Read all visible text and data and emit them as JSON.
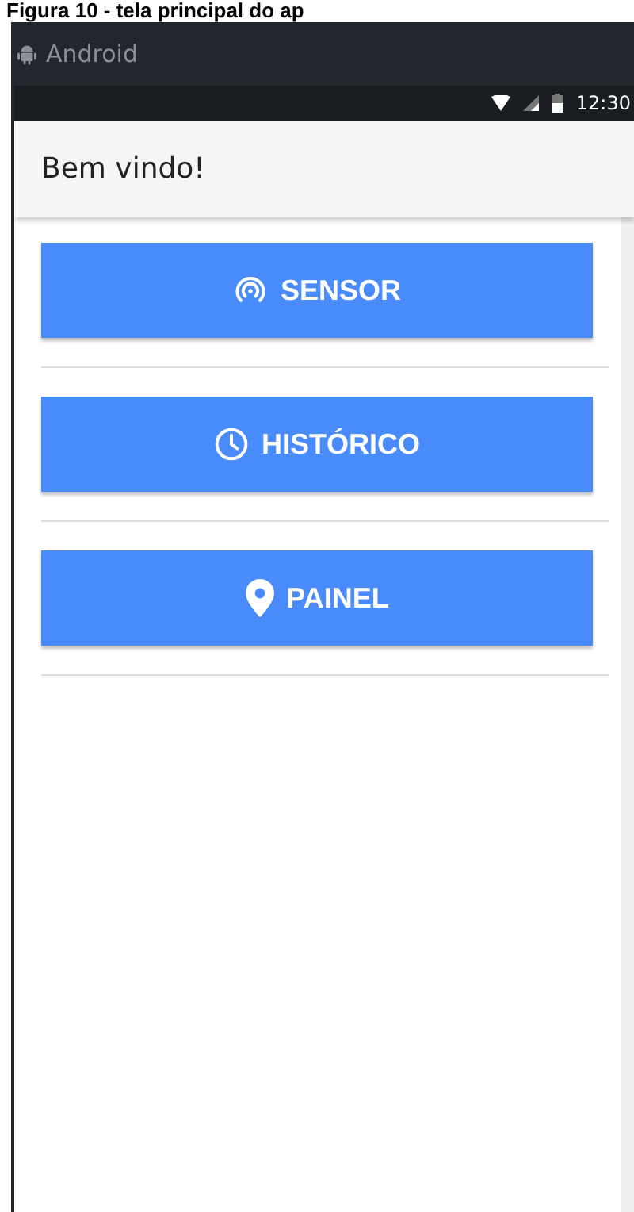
{
  "caption": "Figura 10 - tela principal do ap",
  "window": {
    "title": "Android"
  },
  "status_bar": {
    "time": "12:30"
  },
  "app_bar": {
    "title": "Bem vindo!"
  },
  "buttons": [
    {
      "label": "SENSOR",
      "kind": "sensor"
    },
    {
      "label": "HISTÓRICO",
      "kind": "history"
    },
    {
      "label": "PAINEL",
      "kind": "panel"
    }
  ]
}
